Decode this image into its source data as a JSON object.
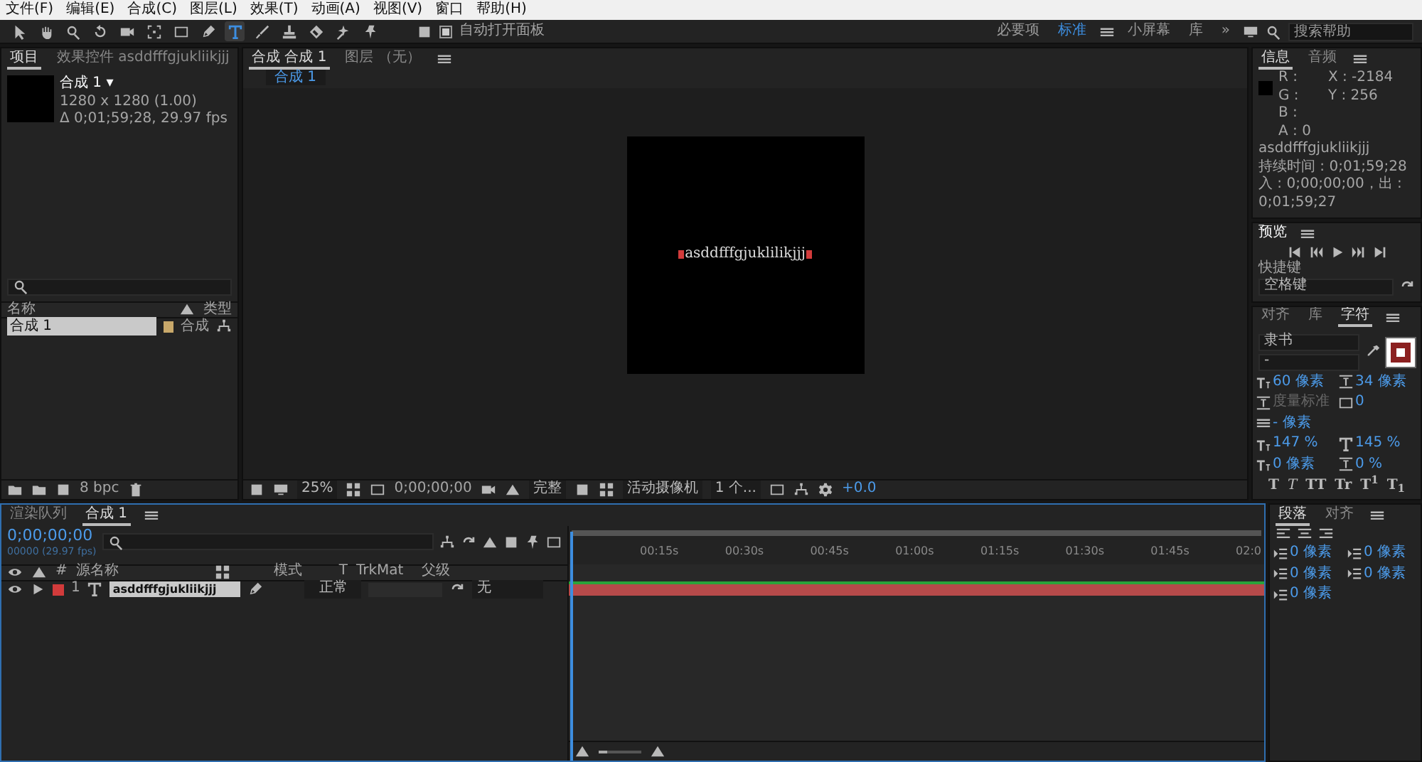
{
  "menu": [
    "文件(F)",
    "编辑(E)",
    "合成(C)",
    "图层(L)",
    "效果(T)",
    "动画(A)",
    "视图(V)",
    "窗口",
    "帮助(H)"
  ],
  "toolbar": {
    "tools": [
      {
        "kind": "arrow",
        "selected": false
      },
      {
        "kind": "hand",
        "selected": false
      },
      {
        "kind": "zoom",
        "selected": false
      },
      {
        "kind": "rotate",
        "selected": false
      },
      {
        "kind": "camera",
        "selected": false
      },
      {
        "kind": "pan",
        "selected": false
      },
      {
        "kind": "rect",
        "selected": false
      },
      {
        "kind": "pen",
        "selected": false
      },
      {
        "kind": "type",
        "selected": true
      },
      {
        "kind": "brush",
        "selected": false
      },
      {
        "kind": "stamp",
        "selected": false
      },
      {
        "kind": "eraser",
        "selected": false
      },
      {
        "kind": "roto",
        "selected": false
      },
      {
        "kind": "pin",
        "selected": false
      }
    ],
    "auto_open": {
      "label": "自动打开面板",
      "checked": true
    },
    "workspaces": [
      {
        "label": "必要项",
        "selected": false
      },
      {
        "label": "标准",
        "selected": true
      },
      {
        "label": "小屏幕",
        "selected": false
      },
      {
        "label": "库",
        "selected": false
      }
    ],
    "overflow": "»",
    "search": {
      "placeholder": "搜索帮助"
    }
  },
  "project": {
    "tabs": [
      {
        "label": "项目",
        "selected": true
      },
      {
        "label": "效果控件 asddfffgjukliikjjj",
        "selected": false
      }
    ],
    "item_title": "合成 1 ▾",
    "item_size": "1280 x 1280 (1.00)",
    "item_duration": "Δ 0;01;59;28, 29.97 fps",
    "columns": [
      "名称",
      "类型"
    ],
    "rows": [
      {
        "name": "合成 1",
        "type": "合成",
        "selected": true
      }
    ],
    "bit_depth": "8 bpc"
  },
  "viewer": {
    "tabs": [
      {
        "label": "合成 合成 1",
        "selected": true
      },
      {
        "label": "图层 （无）",
        "selected": false
      }
    ],
    "breadcrumb": "合成 1",
    "canvas_text": "asddfffgjuklilikjjj",
    "toolbar": {
      "zoom": "25%",
      "timecode": "0;00;00;00",
      "resolution": "完整",
      "camera": "活动摄像机",
      "views": "1 个...",
      "exposure": "+0.0"
    }
  },
  "info": {
    "tabs": [
      {
        "label": "信息",
        "selected": true
      },
      {
        "label": "音频",
        "selected": false
      }
    ],
    "channels": [
      "R :",
      "G :",
      "B :",
      "A : 0"
    ],
    "coords": [
      "X : -2184",
      "Y : 256"
    ],
    "lines": [
      "asddfffgjukliikjjj",
      "持续时间 : 0;01;59;28",
      "入 : 0;00;00;00，出 : 0;01;59;27"
    ]
  },
  "preview": {
    "title": "预览",
    "shortcut_label": "快捷键",
    "shortcut": "空格键"
  },
  "character": {
    "tabs": [
      {
        "label": "对齐",
        "selected": false
      },
      {
        "label": "库",
        "selected": false
      },
      {
        "label": "字符",
        "selected": true
      }
    ],
    "font": "隶书",
    "style": "-",
    "size": "60 像素",
    "leading": "34 像素",
    "kerning": "度量标准",
    "tracking": "0",
    "stroke_width": "- 像素",
    "vertical_scale": "147 %",
    "horizontal_scale": "145 %",
    "baseline": "0 像素",
    "tsume": "0 %",
    "style_buttons": [
      {
        "label": "T",
        "kind": "bold"
      },
      {
        "label": "T",
        "kind": "italic"
      },
      {
        "label": "TT",
        "kind": "caps"
      },
      {
        "label": "Tr",
        "kind": "smallcaps"
      },
      {
        "label": "T$^{1}$",
        "kind": "super"
      },
      {
        "label": "T$_{1}$",
        "kind": "sub"
      }
    ]
  },
  "timeline": {
    "tabs": [
      {
        "label": "渲染队列",
        "selected": false
      },
      {
        "label": "合成 1",
        "selected": true
      }
    ],
    "timecode": "0;00;00;00",
    "frame": "00000 (29.97 fps)",
    "columns": [
      "#",
      "源名称",
      "模式",
      "T",
      "TrkMat",
      "父级"
    ],
    "layers": [
      {
        "number": "1",
        "name": "asddfffgjukliikjjj",
        "mode": "正常",
        "parent": "无",
        "color": "#d23b3b",
        "visible": true,
        "selected": true
      }
    ],
    "zoom_slider": {
      "level": 0.2
    },
    "ticks": [
      "00:15s",
      "00:30s",
      "00:45s",
      "01:00s",
      "01:15s",
      "01:30s",
      "01:45s",
      "02:0"
    ]
  },
  "paragraph": {
    "tabs": [
      {
        "label": "段落",
        "selected": true
      },
      {
        "label": "对齐",
        "selected": false
      }
    ],
    "indents": [
      "0 像素",
      "0 像素",
      "0 像素",
      "0 像素",
      "0 像素"
    ]
  }
}
